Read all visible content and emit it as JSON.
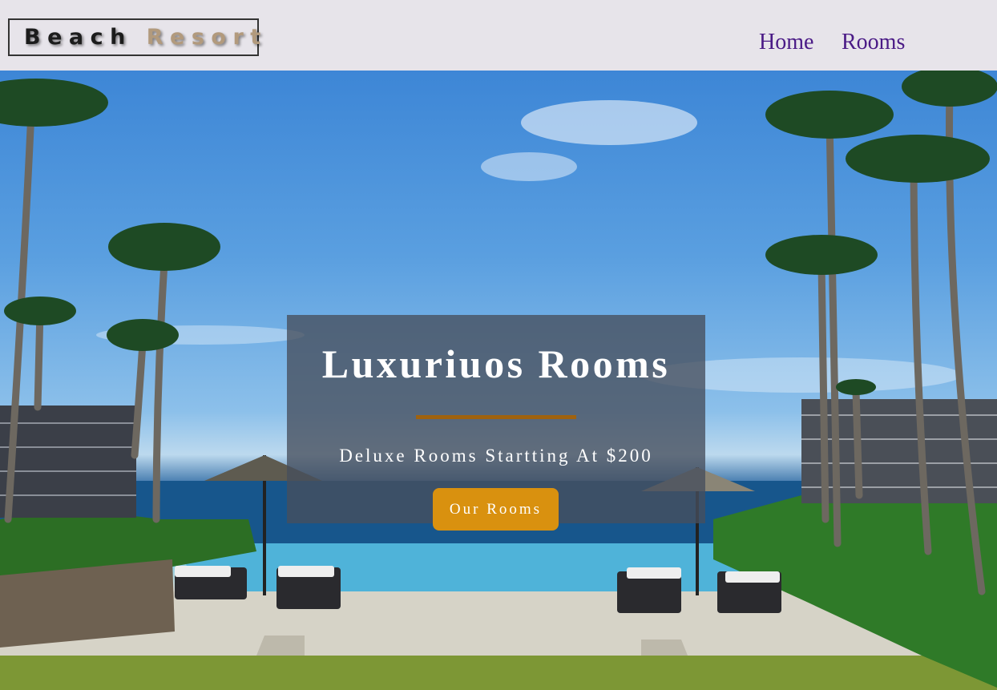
{
  "header": {
    "logo_word1": "Beach",
    "logo_word2": "Resort",
    "links": [
      "Home",
      "Rooms"
    ]
  },
  "hero": {
    "title": "Luxuriuos Rooms",
    "subtitle": "Deluxe Rooms Startting At $200",
    "button_label": "Our Rooms"
  },
  "colors": {
    "nav_bg": "#e7e4ea",
    "link": "#4a1a86",
    "logo_accent": "#b29a7d",
    "rule": "#a0620f",
    "button": "#d9910f"
  }
}
